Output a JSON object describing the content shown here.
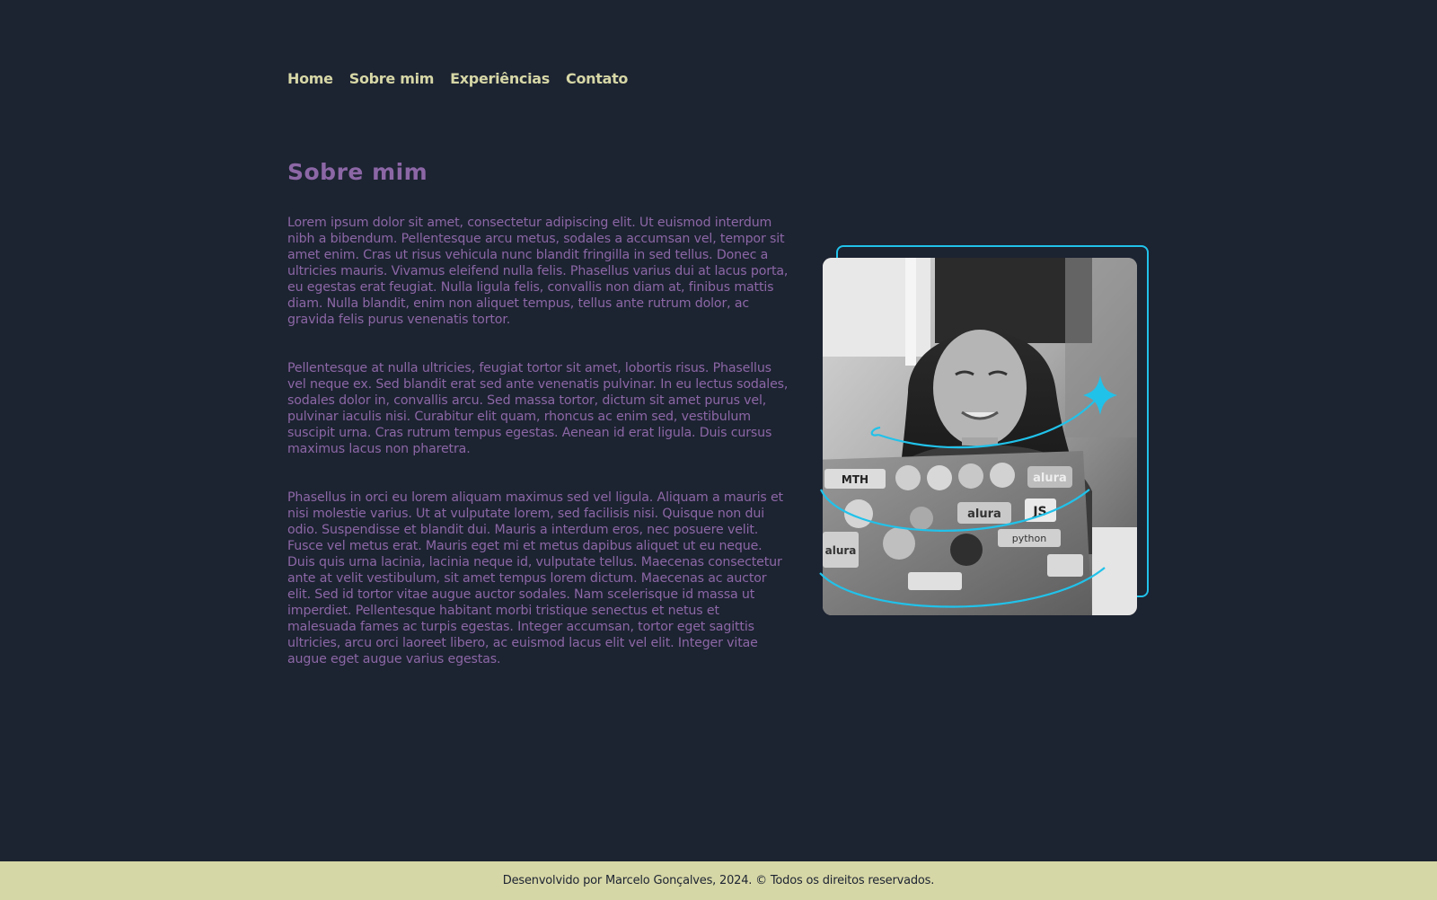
{
  "nav": {
    "items": [
      {
        "label": "Home"
      },
      {
        "label": "Sobre mim"
      },
      {
        "label": "Experiências"
      },
      {
        "label": "Contato"
      }
    ]
  },
  "about": {
    "title": "Sobre mim",
    "paragraphs": [
      "Lorem ipsum dolor sit amet, consectetur adipiscing elit. Ut euismod interdum nibh a bibendum. Pellentesque arcu metus, sodales a accumsan vel, tempor sit amet enim. Cras ut risus vehicula nunc blandit fringilla in sed tellus. Donec a ultricies mauris. Vivamus eleifend nulla felis. Phasellus varius dui at lacus porta, eu egestas erat feugiat. Nulla ligula felis, convallis non diam at, finibus mattis diam. Nulla blandit, enim non aliquet tempus, tellus ante rutrum dolor, ac gravida felis purus venenatis tortor.",
      "Pellentesque at nulla ultricies, feugiat tortor sit amet, lobortis risus. Phasellus vel neque ex. Sed blandit erat sed ante venenatis pulvinar. In eu lectus sodales, sodales dolor in, convallis arcu. Sed massa tortor, dictum sit amet purus vel, pulvinar iaculis nisi. Curabitur elit quam, rhoncus ac enim sed, vestibulum suscipit urna. Cras rutrum tempus egestas. Aenean id erat ligula. Duis cursus maximus lacus non pharetra.",
      "Phasellus in orci eu lorem aliquam maximus sed vel ligula. Aliquam a mauris et nisi molestie varius. Ut at vulputate lorem, sed facilisis nisi. Quisque non dui odio. Suspendisse et blandit dui. Mauris a interdum eros, nec posuere velit. Fusce vel metus erat. Mauris eget mi et metus dapibus aliquet ut eu neque. Duis quis urna lacinia, lacinia neque id, vulputate tellus. Maecenas consectetur ante at velit vestibulum, sit amet tempus lorem dictum. Maecenas ac auctor elit. Sed id tortor vitae augue auctor sodales. Nam scelerisque id massa ut imperdiet. Pellentesque habitant morbi tristique senectus et netus et malesuada fames ac turpis egestas. Integer accumsan, tortor eget sagittis ultricies, arcu orci laoreet libero, ac euismod lacus elit vel elit. Integer vitae augue eget augue varius egestas."
    ],
    "photo_stickers": [
      "MTH",
      "alura",
      "JS",
      "python",
      "alura",
      "alura"
    ]
  },
  "footer": {
    "text": "Desenvolvido por Marcelo Gonçalves, 2024. © Todos os direitos reservados."
  },
  "colors": {
    "background": "#1c2331",
    "nav_text": "#d6d7a6",
    "accent_purple": "#8c67a6",
    "accent_cyan": "#21c2ea",
    "footer_bg": "#d6d7a6"
  }
}
